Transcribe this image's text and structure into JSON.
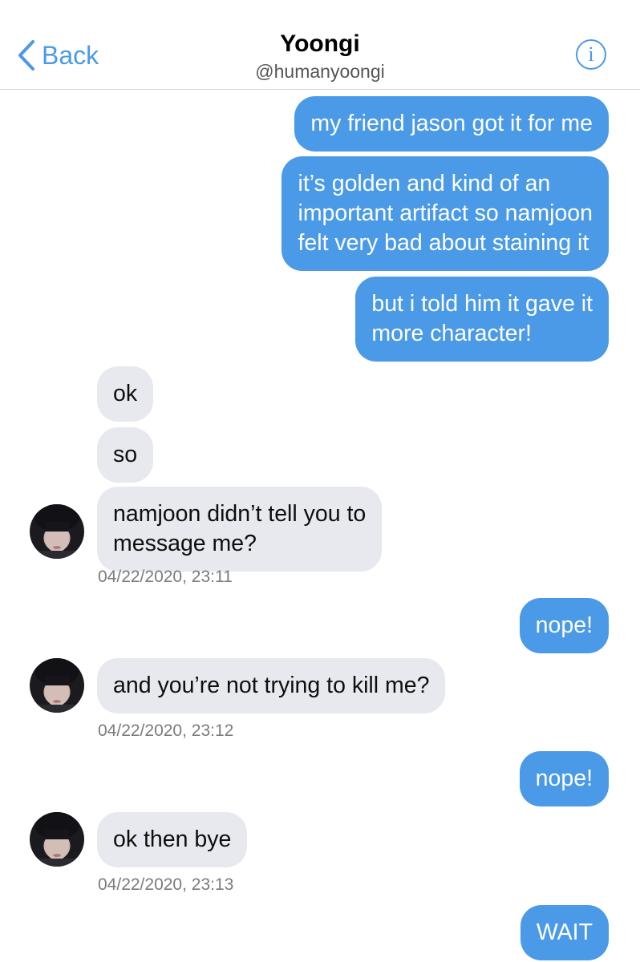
{
  "header": {
    "back_label": "Back",
    "title": "Yoongi",
    "handle": "@humanyoongi",
    "info_icon": "i"
  },
  "messages": [
    {
      "direction": "out",
      "lines": [
        "my friend jason got it for me"
      ]
    },
    {
      "direction": "out",
      "lines": [
        "it’s golden and kind of an",
        "important artifact so namjoon",
        "felt very bad about staining it"
      ]
    },
    {
      "direction": "out",
      "lines": [
        "but i told him it gave it",
        "more character!"
      ]
    },
    {
      "direction": "in",
      "lines": [
        "ok"
      ]
    },
    {
      "direction": "in",
      "lines": [
        "so"
      ]
    },
    {
      "direction": "in",
      "lines": [
        "namjoon didn’t tell you to",
        "message me?"
      ],
      "avatar": true,
      "timestamp": "04/22/2020, 23:11"
    },
    {
      "direction": "out",
      "lines": [
        "nope!"
      ]
    },
    {
      "direction": "in",
      "lines": [
        "and you’re not trying to kill me?"
      ],
      "avatar": true,
      "timestamp": "04/22/2020, 23:12"
    },
    {
      "direction": "out",
      "lines": [
        "nope!"
      ]
    },
    {
      "direction": "in",
      "lines": [
        "ok then bye"
      ],
      "avatar": true,
      "timestamp": "04/22/2020, 23:13"
    },
    {
      "direction": "out",
      "lines": [
        "WAIT"
      ]
    }
  ],
  "colors": {
    "outgoing_bubble": "#4a9ae8",
    "incoming_bubble": "#e8e9ee",
    "accent": "#4a9ae8"
  }
}
